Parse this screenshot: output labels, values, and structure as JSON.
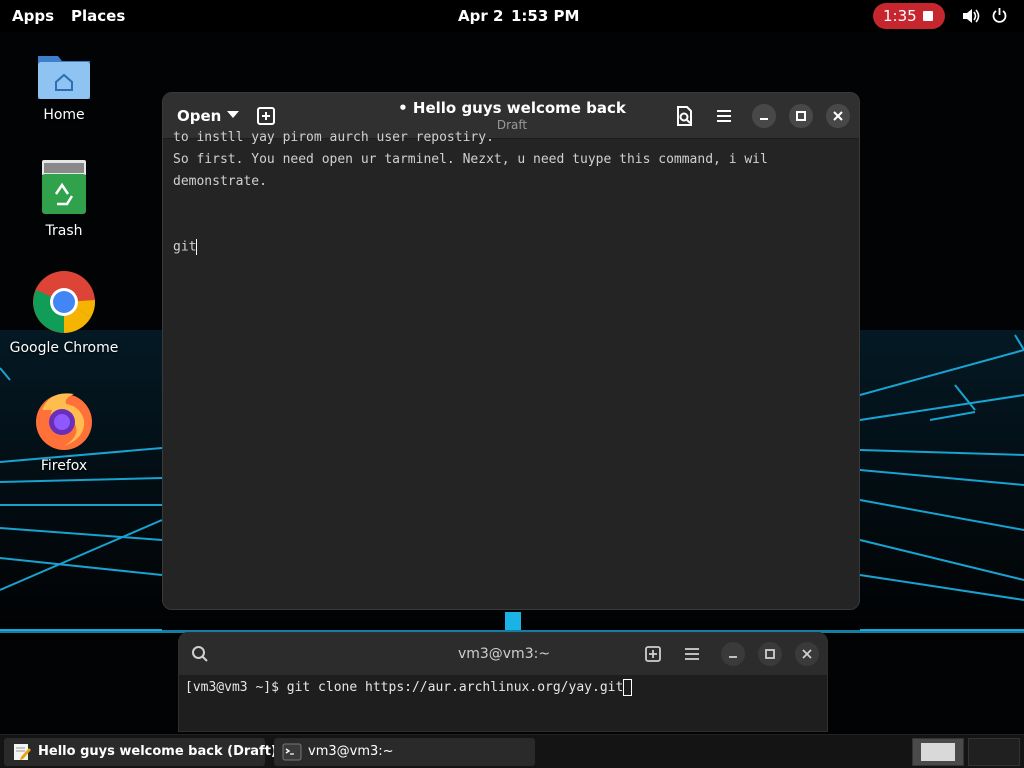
{
  "topbar": {
    "apps": "Apps",
    "places": "Places",
    "date": "Apr 2",
    "time": "1:53 PM",
    "recording_time": "1:35"
  },
  "desktop_icons": [
    {
      "label": "Home",
      "icon": "home-folder-icon"
    },
    {
      "label": "Trash",
      "icon": "trash-icon"
    },
    {
      "label": "Google Chrome",
      "icon": "chrome-icon"
    },
    {
      "label": "Firefox",
      "icon": "firefox-icon"
    }
  ],
  "editor": {
    "open_label": "Open",
    "title_dot": "•",
    "title": "Hello guys welcome back",
    "subtitle": "Draft",
    "lines": [
      "to instll yay pirom aurch user repostiry.",
      "So first. You need open ur tarminel. Nezxt, u need tuype this command, i wil",
      "demonstrate.",
      "",
      "",
      "git"
    ]
  },
  "terminal": {
    "title": "vm3@vm3:~",
    "prompt": "[vm3@vm3 ~]$ ",
    "command": "git clone https://aur.archlinux.org/yay.git"
  },
  "taskbar": {
    "tasks": [
      {
        "label": "Hello guys welcome back (Draft) - ...",
        "icon": "text-editor-icon"
      },
      {
        "label": "vm3@vm3:~",
        "icon": "terminal-icon"
      }
    ]
  },
  "colors": {
    "accent_neon": "#1bb3e6",
    "recording_red": "#c6262e",
    "window_bg": "#242424"
  }
}
